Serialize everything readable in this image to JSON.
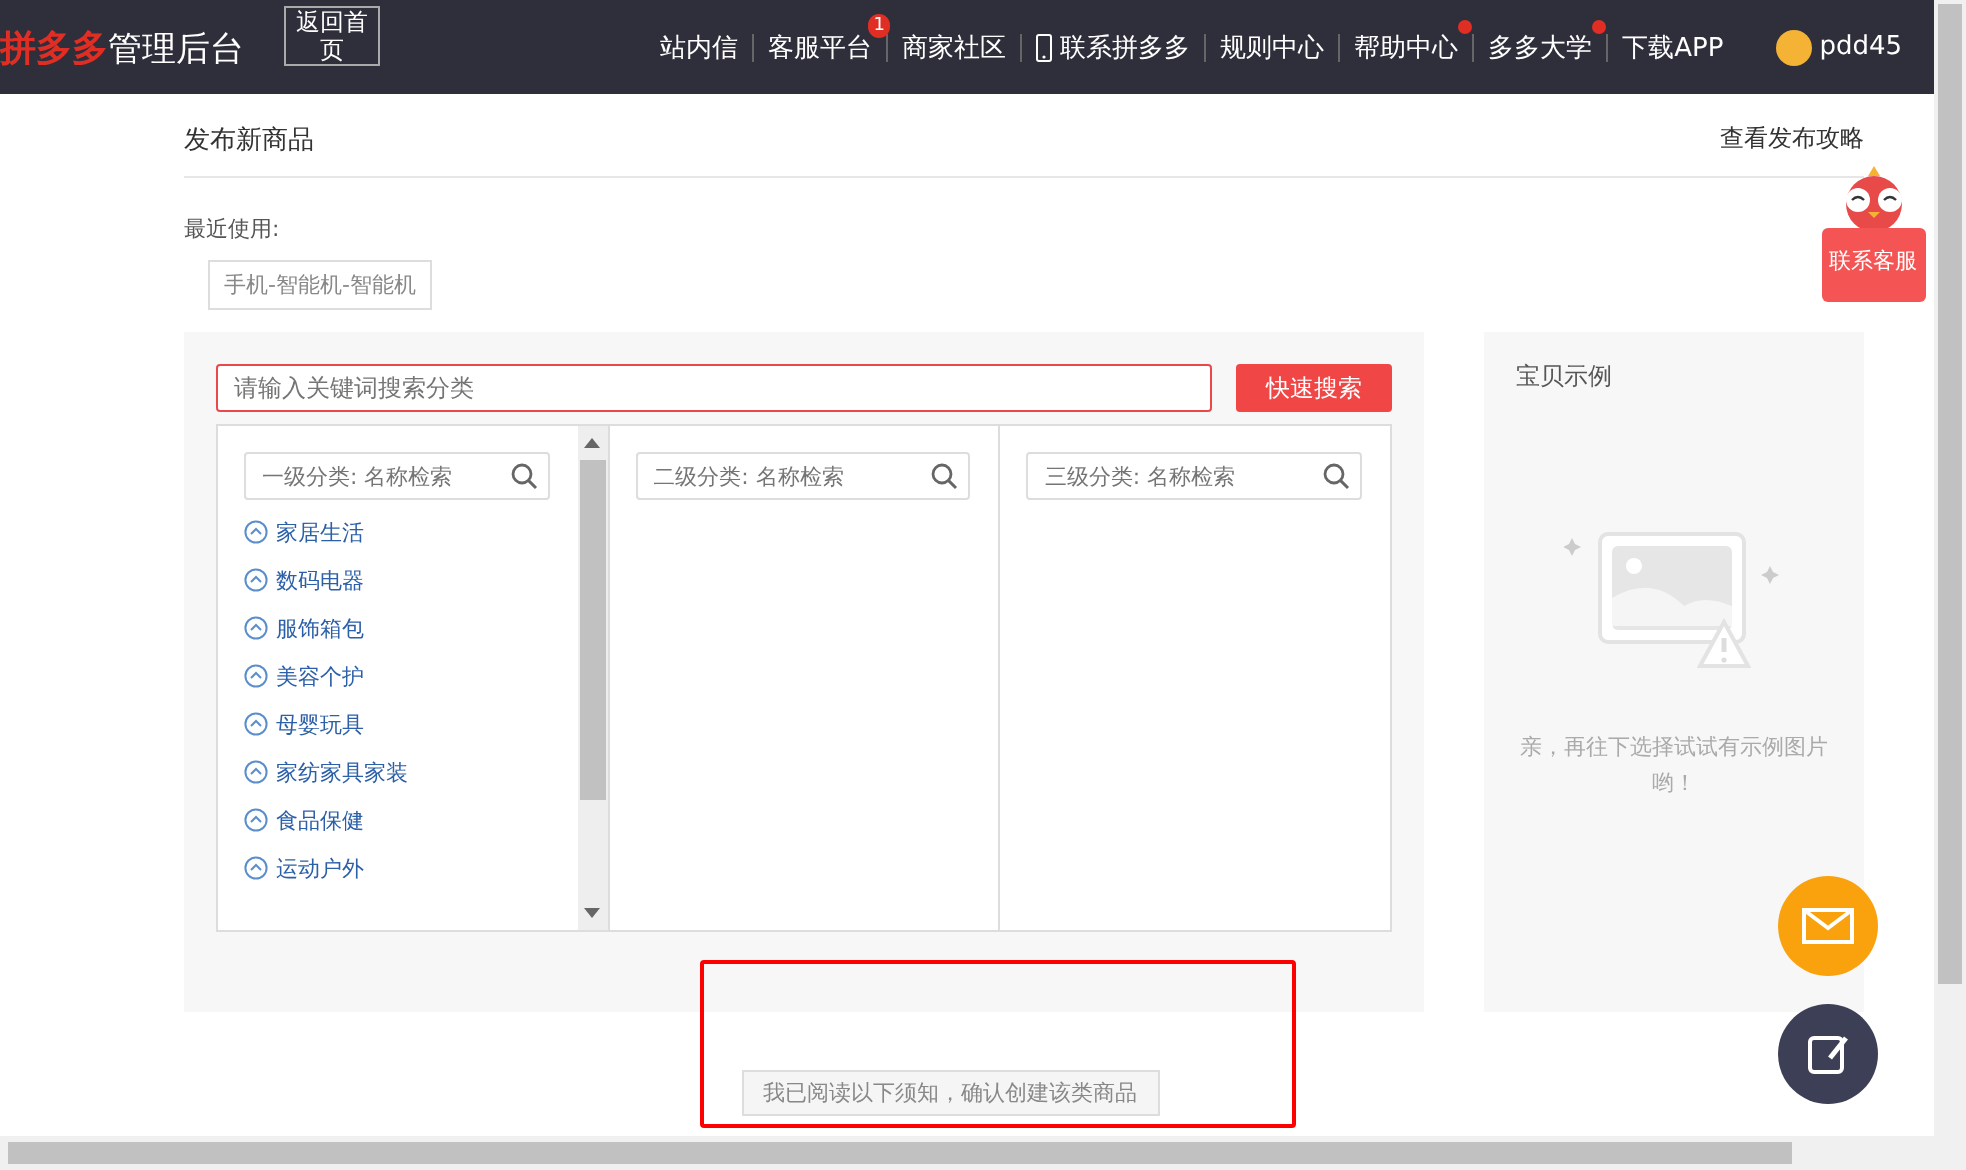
{
  "header": {
    "logo_brand": "拼多多",
    "logo_suffix": "管理后台",
    "back_button": "返回首页",
    "nav": [
      {
        "label": "站内信"
      },
      {
        "label": "客服平台",
        "badge": "1"
      },
      {
        "label": "商家社区"
      },
      {
        "label": "联系拼多多",
        "icon": true
      },
      {
        "label": "规则中心"
      },
      {
        "label": "帮助中心",
        "dot": true
      },
      {
        "label": "多多大学",
        "dot": true
      },
      {
        "label": "下载APP"
      }
    ],
    "user": "pdd45"
  },
  "page": {
    "title": "发布新商品",
    "guide_link": "查看发布攻略",
    "recent_label": "最近使用:",
    "recent_tags": [
      "手机-智能机-智能机"
    ]
  },
  "search": {
    "placeholder": "请输入关键词搜索分类",
    "button": "快速搜索"
  },
  "columns": [
    {
      "placeholder": "一级分类: 名称检索",
      "items": [
        "家居生活",
        "数码电器",
        "服饰箱包",
        "美容个护",
        "母婴玩具",
        "家纺家具家装",
        "食品保健",
        "运动户外"
      ]
    },
    {
      "placeholder": "二级分类: 名称检索"
    },
    {
      "placeholder": "三级分类: 名称检索"
    }
  ],
  "example": {
    "title": "宝贝示例",
    "message": "亲，再往下选择试试有示例图片哟！"
  },
  "confirm_button": "我已阅读以下须知，确认创建该类商品",
  "contact_service": "联系客服"
}
